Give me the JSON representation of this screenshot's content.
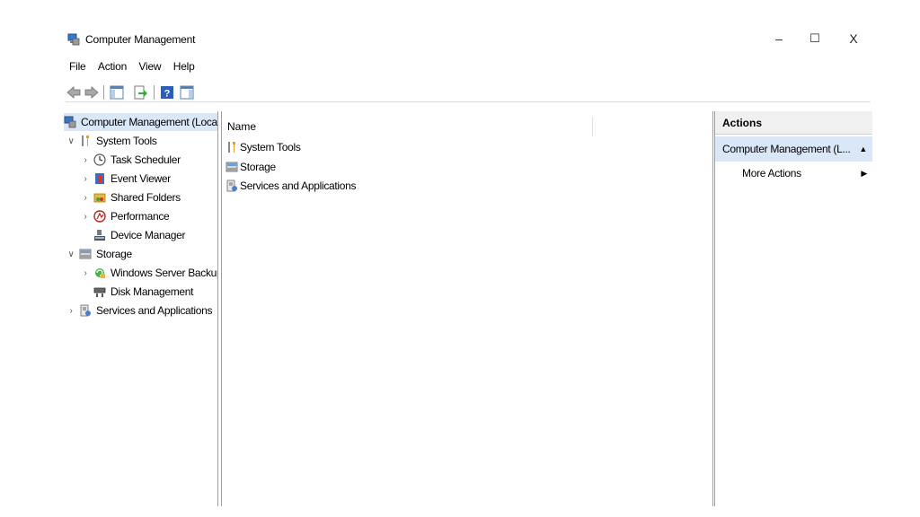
{
  "window": {
    "title": "Computer Management",
    "minimize": "–",
    "maximize": "☐",
    "close": "X"
  },
  "menu": [
    "File",
    "Action",
    "View",
    "Help"
  ],
  "toolbar": {
    "icons": [
      "back-arrow-icon",
      "forward-arrow-icon",
      "show-hide-console-tree-icon",
      "export-list-icon",
      "help-icon",
      "show-hide-action-pane-icon"
    ]
  },
  "tree": {
    "root": "Computer Management (Local",
    "system_tools": "System Tools",
    "task_scheduler": "Task Scheduler",
    "event_viewer": "Event Viewer",
    "shared_folders": "Shared Folders",
    "performance": "Performance",
    "device_manager": "Device Manager",
    "storage": "Storage",
    "windows_server_backup": "Windows Server Backup",
    "disk_management": "Disk Management",
    "services_apps": "Services and Applications"
  },
  "list": {
    "column_name": "Name",
    "items": [
      "System Tools",
      "Storage",
      "Services and Applications"
    ]
  },
  "actions": {
    "header": "Actions",
    "group": "Computer Management (L...",
    "more": "More Actions"
  }
}
